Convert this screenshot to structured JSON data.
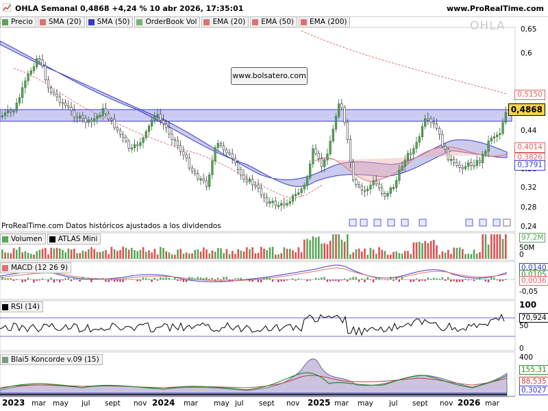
{
  "header": {
    "title": "OHLA Semanal 0,4868 +4,24 % 10 abr 2026, 17:35:01",
    "site": "www.ProRealTime.com"
  },
  "legend": [
    {
      "label": "Precio",
      "color": "#5aa55a"
    },
    {
      "label": "SMA (20)",
      "color": "#e07070"
    },
    {
      "label": "SMA (50)",
      "color": "#3a3ac8"
    },
    {
      "label": "OrderBook Vol",
      "color": "#78b478"
    },
    {
      "label": "EMA (20)",
      "color": "#e07070"
    },
    {
      "label": "EMA (50)",
      "color": "#e07070"
    },
    {
      "label": "EMA (200)",
      "color": "#e07070"
    }
  ],
  "watermark": "OHLA",
  "annotation": "www.bolsatero.com",
  "historical_note": "ProRealTime.com  Datos históricos ajustados a los dividendos",
  "price_axis": [
    "0,65",
    "0,6",
    "0,52",
    "0,48",
    "0,44",
    "0,4",
    "0,36",
    "0,32",
    "0,28",
    "0,24"
  ],
  "price_tags": [
    {
      "value": "0,5150",
      "color": "#e06060"
    },
    {
      "value": "0,4868",
      "color": "#000000",
      "bg": "#f7d64a"
    },
    {
      "value": "0,4014",
      "color": "#e06060"
    },
    {
      "value": "0,3826",
      "color": "#e06060"
    },
    {
      "value": "0,3791",
      "color": "#3a3ac8"
    }
  ],
  "volume_panel": {
    "legend": [
      {
        "label": "Volumen",
        "color": "#5aa55a"
      },
      {
        "label": "ATLAS Mini",
        "color": "#000000"
      }
    ],
    "axis": [
      "97,2M",
      "50M",
      "0"
    ]
  },
  "macd_panel": {
    "legend": [
      {
        "label": "MACD (12 26 9)",
        "color": "#e07070"
      }
    ],
    "axis": [
      "0,0140",
      "0,0105",
      "0,0036",
      "-0,05"
    ]
  },
  "rsi_panel": {
    "legend": [
      {
        "label": "RSI (14)",
        "color": "#000000"
      }
    ],
    "axis": [
      "100",
      "70,924",
      "50",
      "0"
    ]
  },
  "koncorde_panel": {
    "legend": [
      {
        "label": "Blai5 Koncorde v.09 (15)",
        "color": "#7a9c7a"
      }
    ],
    "axis": [
      "400",
      "155,31",
      "88,535",
      "0,3027"
    ]
  },
  "x_axis": [
    {
      "label": "2023",
      "bold": true
    },
    {
      "label": "mar"
    },
    {
      "label": "may"
    },
    {
      "label": "jul"
    },
    {
      "label": "sept"
    },
    {
      "label": "nov"
    },
    {
      "label": "2024",
      "bold": true
    },
    {
      "label": "mar"
    },
    {
      "label": "may"
    },
    {
      "label": "jul"
    },
    {
      "label": "sept"
    },
    {
      "label": "nov"
    },
    {
      "label": "2025",
      "bold": true
    },
    {
      "label": "mar"
    },
    {
      "label": "may"
    },
    {
      "label": "jul"
    },
    {
      "label": "sept"
    },
    {
      "label": "nov"
    },
    {
      "label": "2026",
      "bold": true
    },
    {
      "label": "mar"
    }
  ],
  "colors": {
    "up": "#5aa55a",
    "down": "#c04040",
    "band": "#3a3ac8",
    "resistance": "#3a3ac8"
  }
}
